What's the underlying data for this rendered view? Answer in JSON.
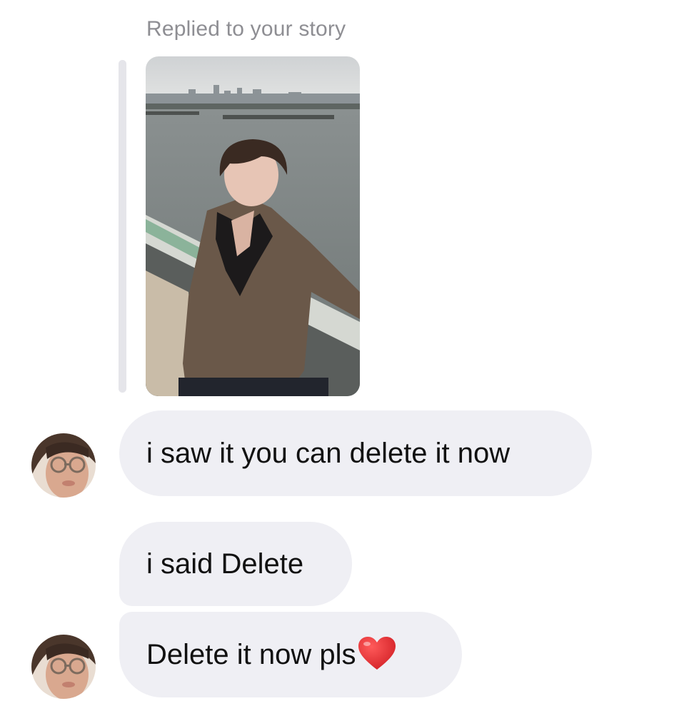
{
  "reply_context": {
    "label": "Replied to your story"
  },
  "messages": [
    {
      "text": "i saw it you can delete it now"
    },
    {
      "text": "i said Delete"
    },
    {
      "text": "Delete it now pls",
      "emoji": "red-heart-icon"
    }
  ],
  "colors": {
    "bubble_bg": "#efeff4",
    "label_gray": "#8e8e93",
    "heart": "#e0262b"
  }
}
